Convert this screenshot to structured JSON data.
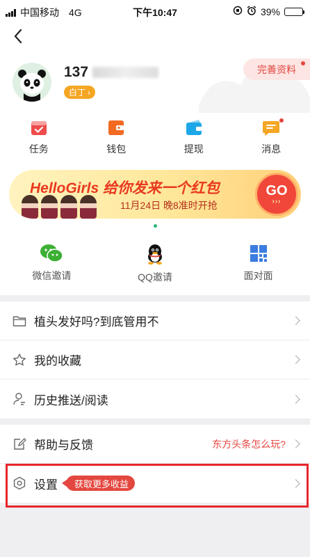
{
  "status_bar": {
    "carrier": "中国移动",
    "network": "4G",
    "time": "下午10:47",
    "battery": "39%",
    "battery_level": 0.39
  },
  "profile": {
    "name": "137",
    "level": "白丁",
    "complete_profile": "完善资料"
  },
  "quick_actions": [
    {
      "label": "任务",
      "icon": "task-icon",
      "color": "#ef4b4b"
    },
    {
      "label": "钱包",
      "icon": "wallet-icon",
      "color": "#f26a21"
    },
    {
      "label": "提现",
      "icon": "withdraw-icon",
      "color": "#1ea7e8"
    },
    {
      "label": "消息",
      "icon": "message-icon",
      "color": "#f5a623"
    }
  ],
  "banner": {
    "brand": "HelloGirls",
    "title": "给你发来一个红包",
    "subtitle": "11月24日 晚8准时开抢",
    "go": "GO",
    "arrows": "›››"
  },
  "invites": [
    {
      "label": "微信邀请",
      "icon": "wechat-icon"
    },
    {
      "label": "QQ邀请",
      "icon": "qq-icon"
    },
    {
      "label": "面对面",
      "icon": "qr-grid-icon"
    }
  ],
  "menu_group_1": [
    {
      "label": "植头发好吗?到底管用不",
      "icon": "folder-icon"
    },
    {
      "label": "我的收藏",
      "icon": "star-icon"
    },
    {
      "label": "历史推送/阅读",
      "icon": "person-history-icon"
    }
  ],
  "menu_group_2": {
    "help": {
      "label": "帮助与反馈",
      "right": "东方头条怎么玩?",
      "icon": "help-edit-icon"
    },
    "settings": {
      "label": "设置",
      "tag": "获取更多收益",
      "icon": "settings-hex-icon"
    }
  },
  "colors": {
    "accent": "#e4473f",
    "badge": "#f5a623",
    "highlight": "#e8262b"
  }
}
